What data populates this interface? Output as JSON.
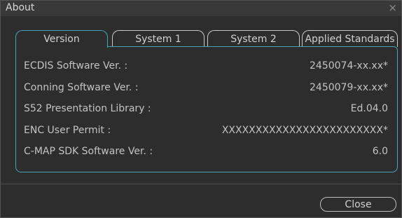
{
  "window": {
    "title": "About"
  },
  "tabs": [
    {
      "label": "Version"
    },
    {
      "label": "System 1"
    },
    {
      "label": "System 2"
    },
    {
      "label": "Applied Standards"
    }
  ],
  "rows": [
    {
      "label": "ECDIS Software Ver. :",
      "value": "2450074-xx.xx*"
    },
    {
      "label": "Conning Software Ver. :",
      "value": "2450079-xx.xx*"
    },
    {
      "label": "S52 Presentation Library :",
      "value": "Ed.04.0"
    },
    {
      "label": "ENC User Permit :",
      "value": "XXXXXXXXXXXXXXXXXXXXXXXX*"
    },
    {
      "label": "C-MAP SDK Software Ver. :",
      "value": "6.0"
    }
  ],
  "buttons": {
    "close_label": "Close"
  },
  "colors": {
    "accent": "#49a3b8",
    "background": "#2d2d2d",
    "text": "#c3c3c3"
  },
  "icons": {
    "close": "close-icon"
  },
  "state": {
    "active_tab": "Version"
  }
}
